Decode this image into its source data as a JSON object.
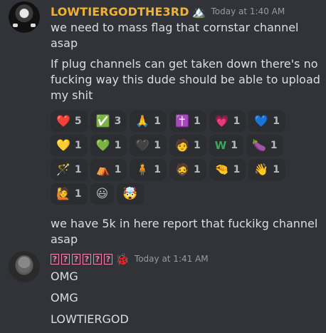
{
  "message1": {
    "username": "LOWTIERGODTHE3RD",
    "badge": "🏔️",
    "timestamp": "Today at 1:40 AM",
    "lines": [
      "we need to mass flag that cornstar channel asap",
      "If plug channels can get taken down there's no",
      "fucking way this dude should be able to upload",
      "my shit"
    ],
    "reactions": [
      [
        {
          "emoji": "❤️",
          "count": "5"
        },
        {
          "emoji": "✅",
          "count": "3"
        },
        {
          "emoji": "🙏",
          "count": "1"
        },
        {
          "emoji": "✝️",
          "count": "1"
        },
        {
          "emoji": "💗",
          "count": "1"
        },
        {
          "emoji": "💙",
          "count": "1"
        }
      ],
      [
        {
          "emoji": "💛",
          "count": "1"
        },
        {
          "emoji": "💚",
          "count": "1"
        },
        {
          "emoji": "🖤",
          "count": "1"
        },
        {
          "emoji": "🧑",
          "count": "1"
        },
        {
          "emoji": "W",
          "count": "1"
        },
        {
          "emoji": "🍆",
          "count": "1"
        }
      ],
      [
        {
          "emoji": "🪄",
          "count": "1"
        },
        {
          "emoji": "⛺",
          "count": "1"
        },
        {
          "emoji": "🧍",
          "count": "1"
        },
        {
          "emoji": "🧔",
          "count": "1"
        },
        {
          "emoji": "🤏",
          "count": "1"
        },
        {
          "emoji": "👋",
          "count": "1"
        }
      ],
      [
        {
          "emoji": "🙋",
          "count": "1"
        },
        {
          "emoji": "😃",
          "count": ""
        },
        {
          "emoji": "🤯",
          "count": ""
        }
      ]
    ],
    "after_lines": [
      "we have 5k in here report that fuckikg channel",
      "asap"
    ]
  },
  "message2": {
    "username_glyphs": [
      "?",
      "?",
      "?",
      "?",
      "?",
      "?"
    ],
    "badge": "🐞",
    "timestamp": "Today at 1:41 AM",
    "lines": [
      "OMG",
      "OMG",
      "LOWTIERGOD"
    ]
  }
}
